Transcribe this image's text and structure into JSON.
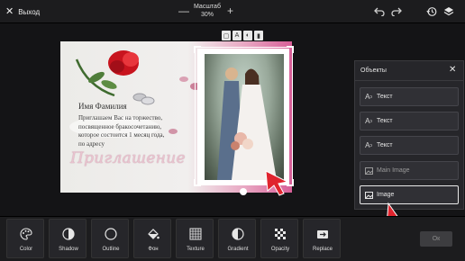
{
  "topbar": {
    "exit_label": "Выход",
    "zoom_label": "Масштаб",
    "zoom_value": "30%",
    "zoom_minus": "—",
    "zoom_plus": "+"
  },
  "card": {
    "name": "Имя Фамилия",
    "body_lines": [
      "Приглашаем Вас на торжество,",
      "посвященное бракосочетанию,",
      "которое состоится 1 месяц года,",
      "по адресу"
    ],
    "invite": "Приглашение"
  },
  "panel": {
    "title": "Объекты",
    "close": "✕",
    "items": [
      {
        "label": "Текст",
        "icon": "text-icon",
        "state": "normal"
      },
      {
        "label": "Текст",
        "icon": "text-icon",
        "state": "normal"
      },
      {
        "label": "Текст",
        "icon": "text-icon",
        "state": "normal"
      },
      {
        "label": "Main Image",
        "icon": "image-icon",
        "state": "dim"
      },
      {
        "label": "Image",
        "icon": "image-icon",
        "state": "active"
      }
    ]
  },
  "tools": [
    {
      "label": "Color",
      "icon": "palette-icon"
    },
    {
      "label": "Shadow",
      "icon": "shadow-icon"
    },
    {
      "label": "Outline",
      "icon": "outline-icon"
    },
    {
      "label": "Фон",
      "icon": "fill-bucket-icon"
    },
    {
      "label": "Texture",
      "icon": "texture-icon"
    },
    {
      "label": "Gradient",
      "icon": "gradient-icon"
    },
    {
      "label": "Opacity",
      "icon": "opacity-icon"
    },
    {
      "label": "Replace",
      "icon": "replace-icon"
    }
  ],
  "ok_label": "Ок",
  "colors": {
    "background": "#111112",
    "toolbar": "#1c1c1e",
    "panel": "#26262a",
    "accent_pink": "#d85f98",
    "cursor_red": "#e0242e"
  }
}
